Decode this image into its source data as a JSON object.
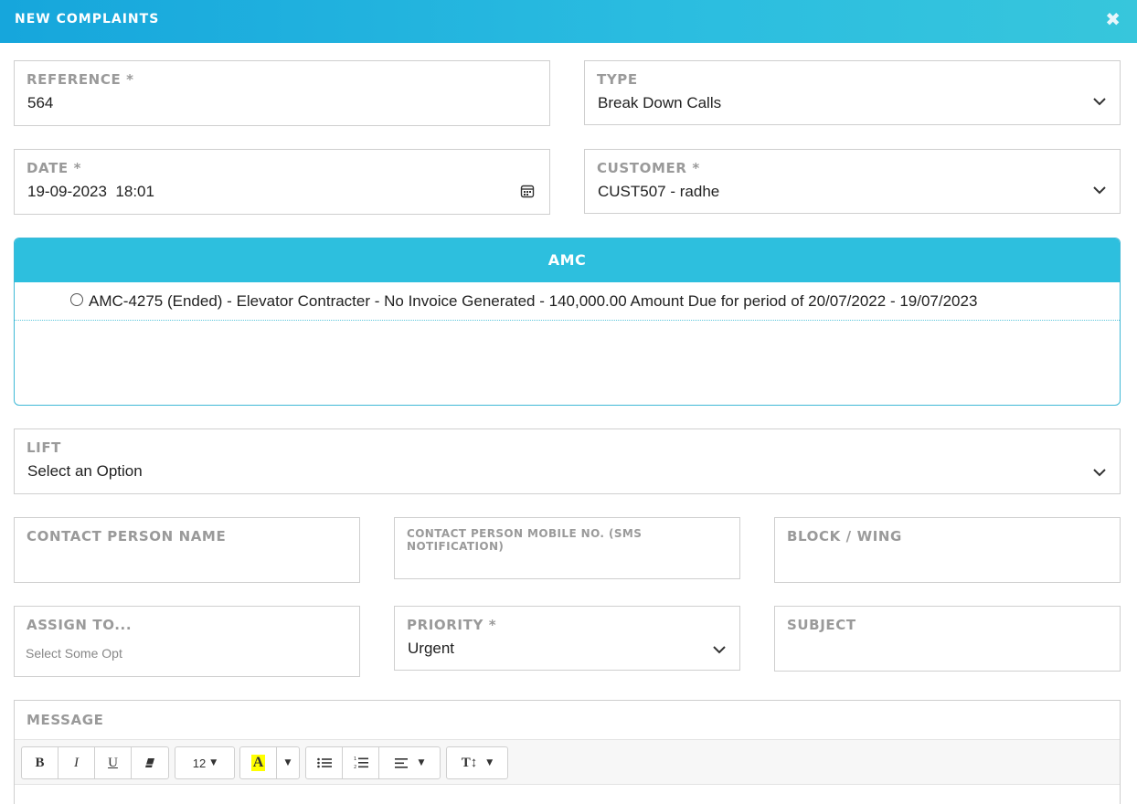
{
  "header": {
    "title": "NEW COMPLAINTS",
    "close_icon": "close-icon"
  },
  "form": {
    "reference": {
      "label": "REFERENCE *",
      "value": "564"
    },
    "type": {
      "label": "TYPE",
      "value": "Break Down Calls"
    },
    "date": {
      "label": "DATE *",
      "value": "19-09-2023  18:01"
    },
    "customer": {
      "label": "CUSTOMER *",
      "value": "CUST507 - radhe"
    },
    "amc": {
      "title": "AMC",
      "option": "AMC-4275 (Ended) - Elevator Contracter - No Invoice Generated - 140,000.00 Amount Due for period of 20/07/2022 - 19/07/2023"
    },
    "lift": {
      "label": "LIFT",
      "value": "Select an Option"
    },
    "contact_name": {
      "label": "CONTACT PERSON NAME",
      "value": ""
    },
    "contact_mobile": {
      "label": "CONTACT PERSON MOBILE NO. (SMS NOTIFICATION)",
      "value": ""
    },
    "block_wing": {
      "label": "BLOCK / WING",
      "value": ""
    },
    "assign_to": {
      "label": "ASSIGN TO...",
      "placeholder": "Select Some Opt"
    },
    "priority": {
      "label": "PRIORITY *",
      "value": "Urgent"
    },
    "subject": {
      "label": "SUBJECT",
      "value": ""
    },
    "message": {
      "label": "MESSAGE",
      "toolbar": {
        "bold": "B",
        "italic": "I",
        "underline": "U",
        "font_size": "12",
        "highlight": "A"
      }
    }
  },
  "colors": {
    "header_start": "#16a6dc",
    "header_end": "#37c6dc",
    "amc_header": "#2dbfde",
    "label_gray": "#9a9a9a",
    "highlight_yellow": "#ffff00"
  }
}
